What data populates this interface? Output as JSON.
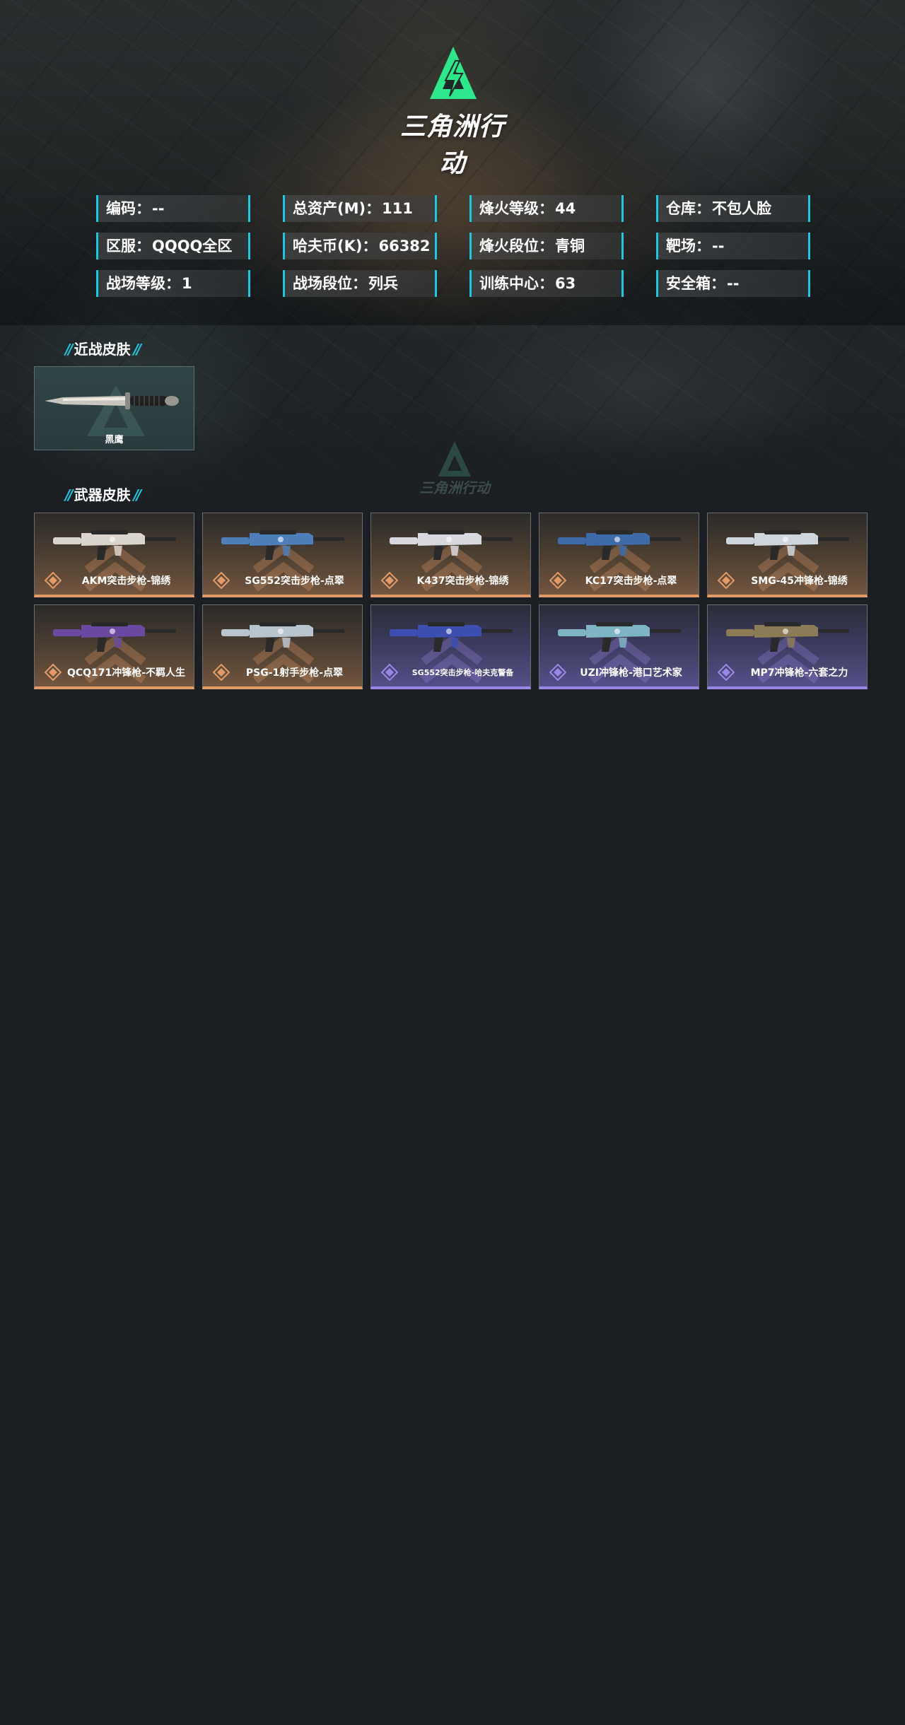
{
  "brand": {
    "name": "三角洲行动",
    "accent": "#2ee68c"
  },
  "stats": [
    {
      "label": "编码：",
      "value": "--"
    },
    {
      "label": "总资产(M)：",
      "value": "111"
    },
    {
      "label": "烽火等级：",
      "value": "44"
    },
    {
      "label": "仓库：",
      "value": "不包人脸"
    },
    {
      "label": "区服：",
      "value": "QQQQ全区"
    },
    {
      "label": "哈夫币(K)：",
      "value": "66382"
    },
    {
      "label": "烽火段位：",
      "value": "青铜"
    },
    {
      "label": "靶场：",
      "value": "--"
    },
    {
      "label": "战场等级：",
      "value": "1"
    },
    {
      "label": "战场段位：",
      "value": "列兵"
    },
    {
      "label": "训练中心：",
      "value": "63"
    },
    {
      "label": "安全箱：",
      "value": "--"
    }
  ],
  "melee": {
    "title": "近战皮肤",
    "items": [
      {
        "name": "黑鹰"
      }
    ]
  },
  "weapons": {
    "title": "武器皮肤",
    "items": [
      {
        "name": "AKM突击步枪-锦绣",
        "rarity": "orange"
      },
      {
        "name": "SG552突击步枪-点翠",
        "rarity": "orange"
      },
      {
        "name": "K437突击步枪-锦绣",
        "rarity": "orange"
      },
      {
        "name": "KC17突击步枪-点翠",
        "rarity": "orange"
      },
      {
        "name": "SMG-45冲锋枪-锦绣",
        "rarity": "orange"
      },
      {
        "name": "QCQ171冲锋枪-不羁人生",
        "rarity": "orange"
      },
      {
        "name": "PSG-1射手步枪-点翠",
        "rarity": "orange"
      },
      {
        "name": "SG552突击步枪-哈夫克警备",
        "rarity": "purple"
      },
      {
        "name": "UZI冲锋枪-港口艺术家",
        "rarity": "purple"
      },
      {
        "name": "MP7冲锋枪-六套之力",
        "rarity": "purple"
      }
    ]
  },
  "colors": {
    "background": "#1b1e22",
    "stat_border": "#1fc6e0",
    "orange_rarity": "#e39a66",
    "purple_rarity": "#9a86e6"
  }
}
